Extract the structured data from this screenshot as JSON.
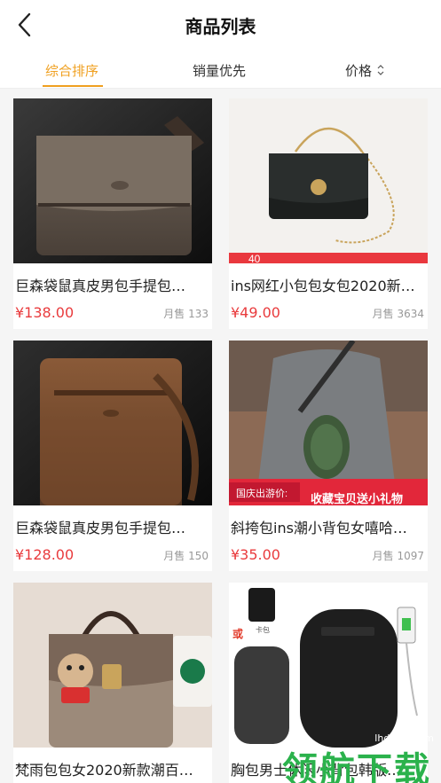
{
  "header": {
    "title": "商品列表"
  },
  "tabs": [
    {
      "label": "综合排序",
      "active": true
    },
    {
      "label": "销量优先",
      "active": false
    },
    {
      "label": "价格",
      "active": false
    }
  ],
  "products": [
    {
      "name": "巨森袋鼠真皮男包手提包…",
      "price": "¥138.00",
      "sales_label": "月售",
      "sales": "133",
      "image": "brown-leather-messenger-bag"
    },
    {
      "name": "ins网红小包包女包2020新…",
      "price": "¥49.00",
      "sales_label": "月售",
      "sales": "3634",
      "image": "black-quilted-chain-bag",
      "image_text": "40"
    },
    {
      "name": "巨森袋鼠真皮男包手提包…",
      "price": "¥128.00",
      "sales_label": "月售",
      "sales": "150",
      "image": "brown-leather-shoulder-bag"
    },
    {
      "name": "斜挎包ins潮小背包女嘻哈…",
      "price": "¥35.00",
      "sales_label": "月售",
      "sales": "1097",
      "image": "chest-sling-bag-model",
      "banner_left": "国庆出游价:",
      "banner_right": "收藏宝贝送小礼物"
    },
    {
      "name": "梵雨包包女2020新款潮百…",
      "price": "",
      "sales_label": "",
      "sales": "",
      "image": "printed-handbag-with-bear"
    },
    {
      "name": "胸包男士休闲小背包韩版…",
      "price": "",
      "sales_label": "",
      "sales": "",
      "image": "black-backpack-set",
      "tag_or": "或",
      "tag_card": "卡包"
    }
  ],
  "watermark": {
    "text": "领航下载",
    "url": "lhdown.com"
  },
  "colors": {
    "accent": "#f0a020",
    "price": "#e93b3d",
    "watermark": "#2bb24c"
  }
}
